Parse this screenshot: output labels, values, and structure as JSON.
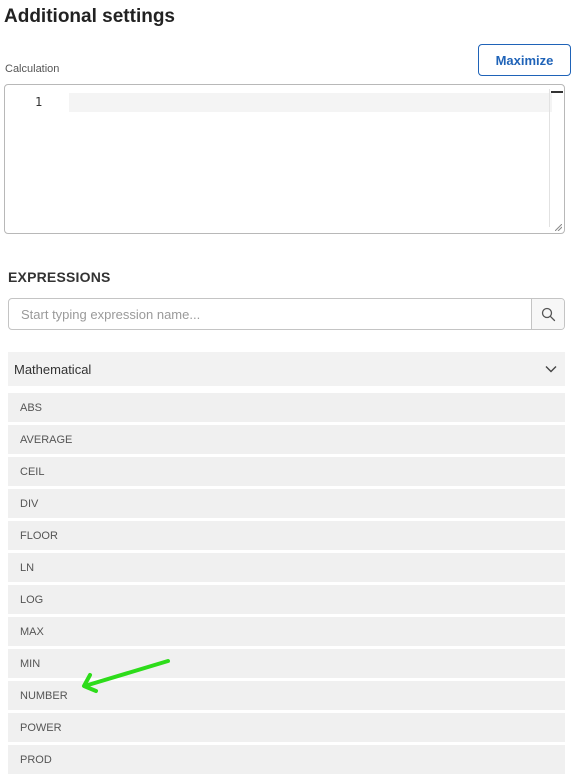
{
  "header": {
    "title": "Additional settings"
  },
  "calculation": {
    "label": "Calculation",
    "maximize_label": "Maximize",
    "line_numbers": [
      "1"
    ]
  },
  "expressions": {
    "heading": "EXPRESSIONS",
    "search_placeholder": "Start typing expression name...",
    "search_value": "",
    "category": "Mathematical",
    "items": [
      "ABS",
      "AVERAGE",
      "CEIL",
      "DIV",
      "FLOOR",
      "LN",
      "LOG",
      "MAX",
      "MIN",
      "NUMBER",
      "POWER",
      "PROD"
    ]
  },
  "annotation": {
    "arrow_color": "#2ddc1a",
    "points_to": "NUMBER"
  },
  "colors": {
    "accent": "#1f63b8",
    "row_background": "#f0f0f0"
  },
  "icons": {
    "search": "search-icon",
    "chevron": "chevron-down-icon",
    "resize": "resize-handle-icon"
  }
}
